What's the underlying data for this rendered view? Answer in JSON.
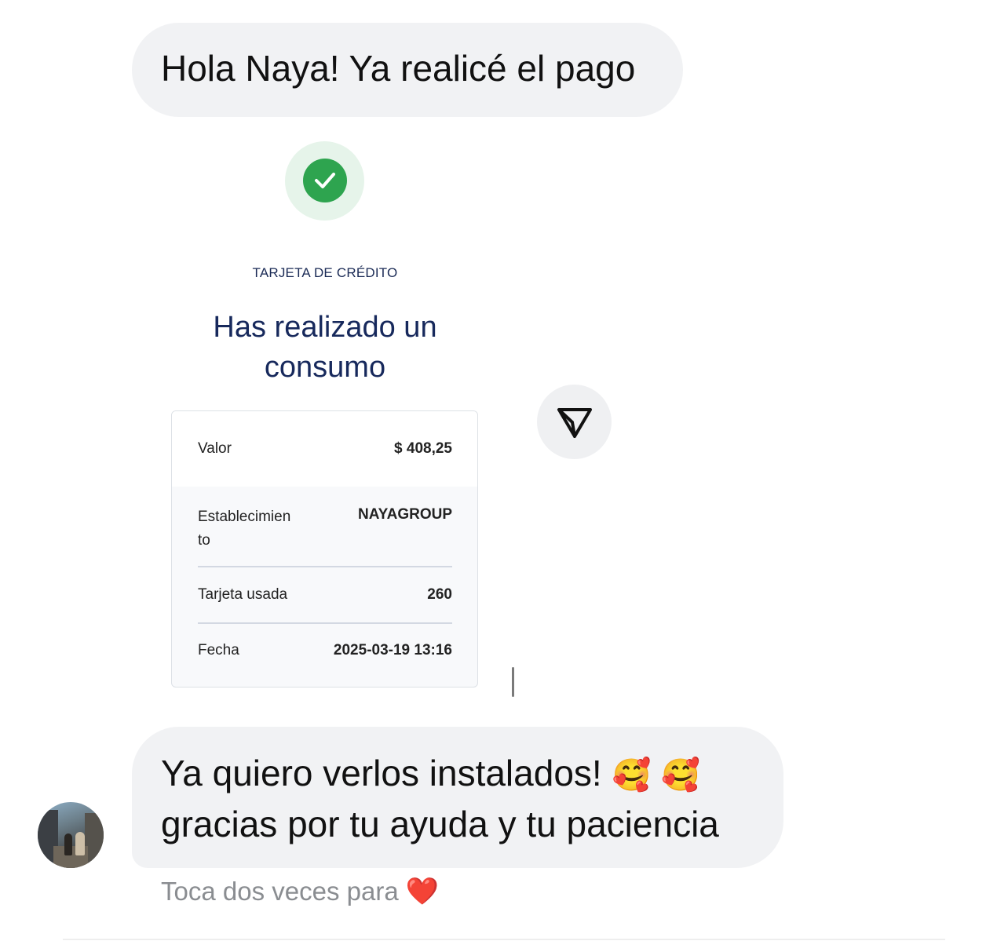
{
  "messages": {
    "first": "Hola Naya! Ya realicé el pago",
    "second_line1": "Ya quiero verlos instalados!",
    "second_emojis": "🥰 🥰",
    "second_line2": "gracias por tu ayuda y tu paciencia"
  },
  "receipt_image": {
    "label": "TARJETA DE CRÉDITO",
    "title_line1": "Has realizado un",
    "title_line2": "consumo",
    "rows": [
      {
        "label": "Valor",
        "value": "$ 408,25"
      },
      {
        "label_line1": "Establecimien",
        "label_line2": "to",
        "value": "NAYAGROUP"
      },
      {
        "label": "Tarjeta usada",
        "value": "260"
      },
      {
        "label": "Fecha",
        "value": "2025-03-19 13:16"
      }
    ]
  },
  "hint": {
    "text": "Toca dos veces para",
    "heart": "❤️"
  },
  "icons": {
    "check": "check-icon",
    "send": "send-icon",
    "avatar": "avatar"
  },
  "colors": {
    "bubble": "#f1f2f4",
    "check_green": "#2ea44f",
    "title_blue": "#17295c",
    "heart_red": "#e0152f"
  }
}
